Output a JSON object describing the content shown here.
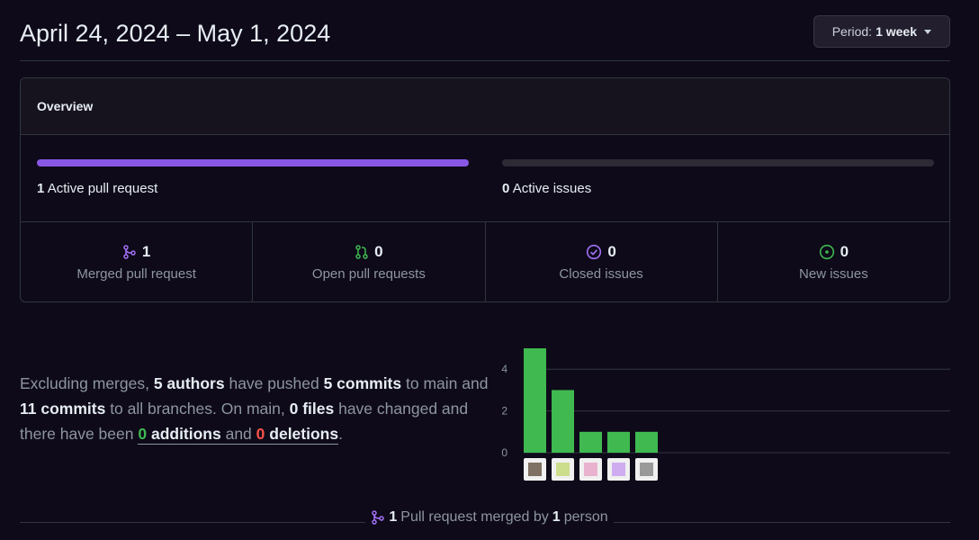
{
  "header": {
    "date_range": "April 24, 2024 – May 1, 2024",
    "period_label": "Period:",
    "period_value": "1 week"
  },
  "overview": {
    "title": "Overview",
    "pull_requests": {
      "count": "1",
      "label": "Active pull request",
      "fill_fraction": 1.0,
      "color": "#8957e5"
    },
    "issues": {
      "count": "0",
      "label": "Active issues",
      "fill_fraction": 0.0
    },
    "stats": [
      {
        "icon": "git-merge-icon",
        "count": "1",
        "label": "Merged pull request",
        "color": "#a371f7"
      },
      {
        "icon": "git-pull-request-icon",
        "count": "0",
        "label": "Open pull requests",
        "color": "#3fb950"
      },
      {
        "icon": "issue-closed-icon",
        "count": "0",
        "label": "Closed issues",
        "color": "#a371f7"
      },
      {
        "icon": "issue-opened-icon",
        "count": "0",
        "label": "New issues",
        "color": "#3fb950"
      }
    ]
  },
  "summary": {
    "p1": "Excluding merges, ",
    "authors": "5 authors",
    "p2": " have pushed ",
    "commits_main": "5 commits",
    "p3": " to main and ",
    "commits_all": "11 commits",
    "p4": " to all branches. On main, ",
    "files": "0 files",
    "p5": " have changed and there have been ",
    "additions_num": "0",
    "additions_word": " additions",
    "and": " and ",
    "deletions_num": "0",
    "deletions_word": " deletions",
    "end": "."
  },
  "chart_data": {
    "type": "bar",
    "categories": [
      "author-1",
      "author-2",
      "author-3",
      "author-4",
      "author-5"
    ],
    "values": [
      5,
      3,
      1,
      1,
      1
    ],
    "yticks": [
      0,
      2,
      4
    ],
    "ylim": [
      0,
      5
    ],
    "bar_color": "#3fb950",
    "title": "",
    "xlabel": "",
    "ylabel": ""
  },
  "footer": {
    "count": "1",
    "text1": " Pull request merged by ",
    "people": "1",
    "text2": " person"
  }
}
